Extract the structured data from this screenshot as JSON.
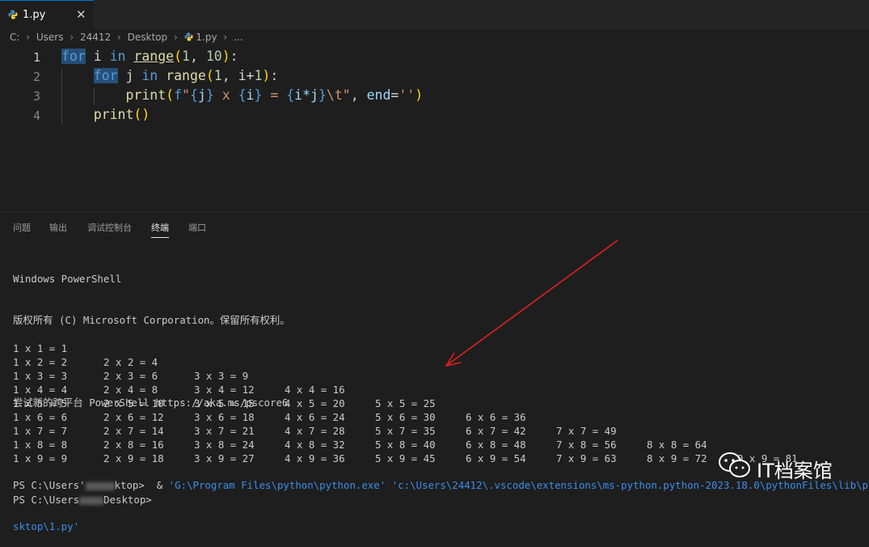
{
  "tab": {
    "filename": "1.py",
    "close": "✕"
  },
  "breadcrumb": [
    "C:",
    "Users",
    "24412",
    "Desktop",
    "1.py",
    "..."
  ],
  "editor": {
    "line_numbers": [
      "1",
      "2",
      "3",
      "4"
    ],
    "lines": [
      [
        [
          "kwh",
          "for"
        ],
        [
          "plain",
          " i "
        ],
        [
          "kw",
          "in"
        ],
        [
          "plain",
          " "
        ],
        [
          "fnu",
          "range"
        ],
        [
          "p1",
          "("
        ],
        [
          "num",
          "1"
        ],
        [
          "plain",
          ", "
        ],
        [
          "num",
          "10"
        ],
        [
          "p1",
          ")"
        ],
        [
          "plain",
          ":"
        ]
      ],
      [
        [
          "plain",
          "    "
        ],
        [
          "kwh",
          "for"
        ],
        [
          "plain",
          " j "
        ],
        [
          "kw",
          "in"
        ],
        [
          "plain",
          " "
        ],
        [
          "fn",
          "range"
        ],
        [
          "p1",
          "("
        ],
        [
          "num",
          "1"
        ],
        [
          "plain",
          ", i+"
        ],
        [
          "num",
          "1"
        ],
        [
          "p1",
          ")"
        ],
        [
          "plain",
          ":"
        ]
      ],
      [
        [
          "plain",
          "        "
        ],
        [
          "fn",
          "print"
        ],
        [
          "p1",
          "("
        ],
        [
          "kw",
          "f"
        ],
        [
          "str",
          "\""
        ],
        [
          "brace",
          "{"
        ],
        [
          "var",
          "j"
        ],
        [
          "brace",
          "}"
        ],
        [
          "str",
          " x "
        ],
        [
          "brace",
          "{"
        ],
        [
          "var",
          "i"
        ],
        [
          "brace",
          "}"
        ],
        [
          "str",
          " = "
        ],
        [
          "brace",
          "{"
        ],
        [
          "var",
          "i*j"
        ],
        [
          "brace",
          "}"
        ],
        [
          "str",
          "\\t\""
        ],
        [
          "plain",
          ", "
        ],
        [
          "var",
          "end"
        ],
        [
          "plain",
          "="
        ],
        [
          "str",
          "''"
        ],
        [
          "p1",
          ")"
        ]
      ],
      [
        [
          "plain",
          "    "
        ],
        [
          "fn",
          "print"
        ],
        [
          "p1",
          "()"
        ]
      ]
    ]
  },
  "panel_tabs": [
    "问题",
    "输出",
    "调试控制台",
    "终端",
    "端口"
  ],
  "panel_active": "终端",
  "terminal": {
    "line1": "Windows PowerShell",
    "line2": "版权所有 (C) Microsoft Corporation。保留所有权利。",
    "line3": "尝试新的跨平台 PowerShell https://aka.ms/pscore6",
    "prompt1_a": "PS C:\\Users'",
    "prompt1_b": "ktop>  & ",
    "cmd": "'G:\\Program Files\\python\\python.exe' 'c:\\Users\\24412\\.vscode\\extensions\\ms-python.python-2023.18.0\\pythonFiles\\lib\\python",
    "cmd_cont": "sktop\\1.py'",
    "prompt2_a": "PS C:\\Users",
    "prompt2_b": "Desktop>"
  },
  "table": [
    [
      "1 x 1 = 1"
    ],
    [
      "1 x 2 = 2",
      "2 x 2 = 4"
    ],
    [
      "1 x 3 = 3",
      "2 x 3 = 6",
      "3 x 3 = 9"
    ],
    [
      "1 x 4 = 4",
      "2 x 4 = 8",
      "3 x 4 = 12",
      "4 x 4 = 16"
    ],
    [
      "1 x 5 = 5",
      "2 x 5 = 10",
      "3 x 5 = 15",
      "4 x 5 = 20",
      "5 x 5 = 25"
    ],
    [
      "1 x 6 = 6",
      "2 x 6 = 12",
      "3 x 6 = 18",
      "4 x 6 = 24",
      "5 x 6 = 30",
      "6 x 6 = 36"
    ],
    [
      "1 x 7 = 7",
      "2 x 7 = 14",
      "3 x 7 = 21",
      "4 x 7 = 28",
      "5 x 7 = 35",
      "6 x 7 = 42",
      "7 x 7 = 49"
    ],
    [
      "1 x 8 = 8",
      "2 x 8 = 16",
      "3 x 8 = 24",
      "4 x 8 = 32",
      "5 x 8 = 40",
      "6 x 8 = 48",
      "7 x 8 = 56",
      "8 x 8 = 64"
    ],
    [
      "1 x 9 = 9",
      "2 x 9 = 18",
      "3 x 9 = 27",
      "4 x 9 = 36",
      "5 x 9 = 45",
      "6 x 9 = 54",
      "7 x 9 = 63",
      "8 x 9 = 72",
      "9 x 9 = 81"
    ]
  ],
  "watermark": "IT档案馆",
  "colors": {
    "accent": "#0078d4",
    "arrow": "#e02020",
    "link": "#3b8eea"
  }
}
